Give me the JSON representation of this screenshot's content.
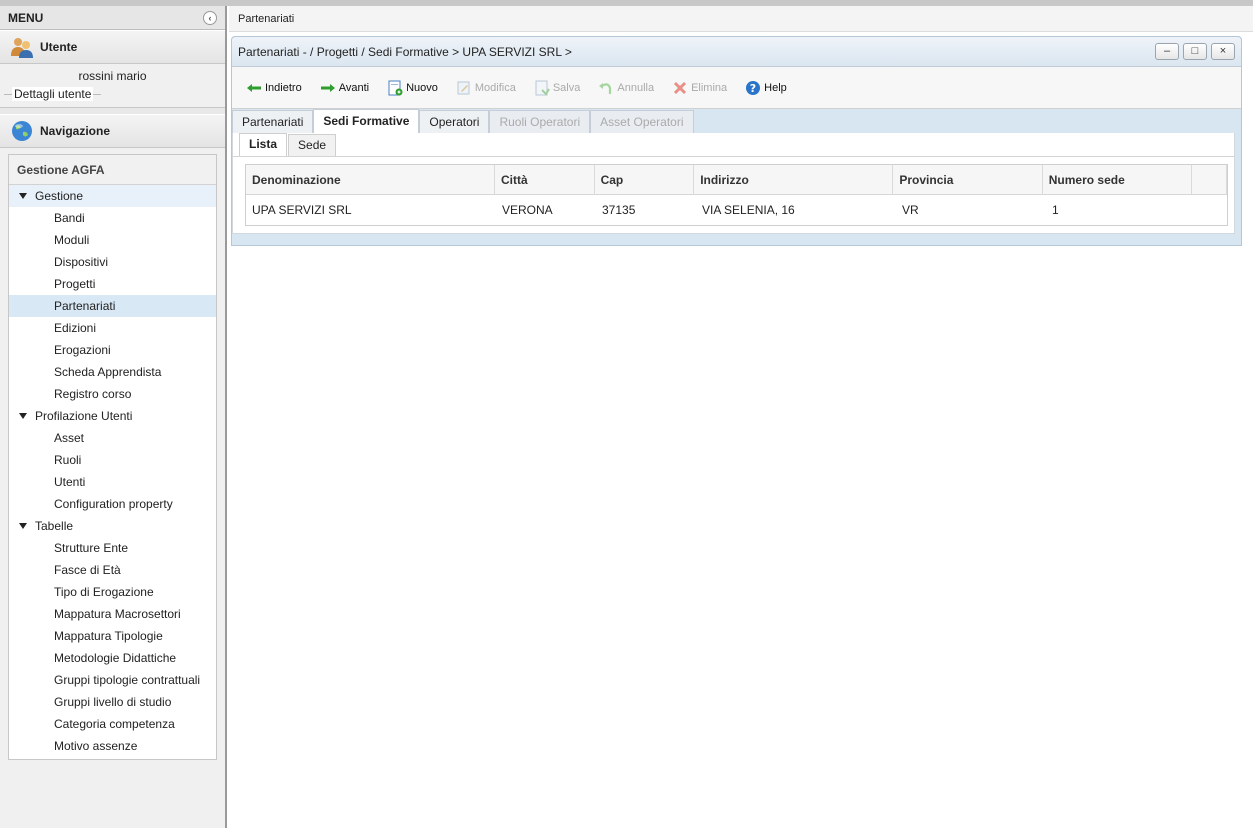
{
  "sidebar": {
    "menu_title": "MENU",
    "user_section_title": "Utente",
    "user_name": "rossini mario",
    "user_details_label": "Dettagli utente",
    "nav_section_title": "Navigazione",
    "nav_box_title": "Gestione AGFA",
    "groups": [
      {
        "label": "Gestione",
        "items": [
          "Bandi",
          "Moduli",
          "Dispositivi",
          "Progetti",
          "Partenariati",
          "Edizioni",
          "Erogazioni",
          "Scheda Apprendista",
          "Registro corso"
        ]
      },
      {
        "label": "Profilazione Utenti",
        "items": [
          "Asset",
          "Ruoli",
          "Utenti",
          "Configuration property"
        ]
      },
      {
        "label": "Tabelle",
        "items": [
          "Strutture Ente",
          "Fasce di Età",
          "Tipo di Erogazione",
          "Mappatura Macrosettori",
          "Mappatura Tipologie",
          "Metodologie Didattiche",
          "Gruppi tipologie contrattuali",
          "Gruppi livello di studio",
          "Categoria competenza",
          "Motivo assenze"
        ]
      }
    ],
    "selected_item": "Partenariati"
  },
  "main": {
    "page_tab": "Partenariati",
    "window_title": "Partenariati - / Progetti / Sedi Formative > UPA SERVIZI SRL >",
    "window_buttons": [
      "–",
      "□",
      "×"
    ],
    "toolbar": {
      "back": "Indietro",
      "forward": "Avanti",
      "new": "Nuovo",
      "edit": "Modifica",
      "save": "Salva",
      "cancel": "Annulla",
      "delete": "Elimina",
      "help": "Help"
    },
    "tabs": [
      "Partenariati",
      "Sedi Formative",
      "Operatori",
      "Ruoli Operatori",
      "Asset Operatori"
    ],
    "active_tab": "Sedi Formative",
    "subtabs": [
      "Lista",
      "Sede"
    ],
    "active_subtab": "Lista",
    "grid": {
      "columns": [
        "Denominazione",
        "Città",
        "Cap",
        "Indirizzo",
        "Provincia",
        "Numero sede"
      ],
      "rows": [
        [
          "UPA SERVIZI SRL",
          "VERONA",
          "37135",
          "VIA SELENIA, 16",
          "VR",
          "1"
        ]
      ]
    }
  },
  "colors": {
    "accent": "#d8e6f2",
    "selection": "#d9e8f5",
    "delete_red": "#e05a4a",
    "arrow_green": "#2e9e2e"
  }
}
